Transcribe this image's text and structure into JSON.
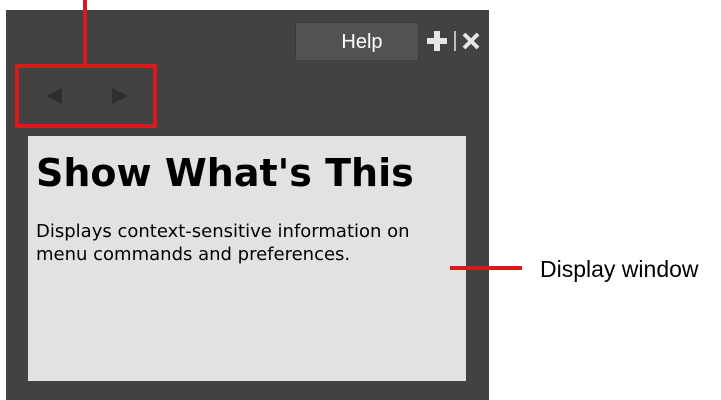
{
  "panel": {
    "tab_label": "Help",
    "icons": {
      "add": "plus-icon",
      "close": "close-icon",
      "back": "back-arrow-icon",
      "forward": "forward-arrow-icon"
    },
    "colors": {
      "panel_bg": "#424242",
      "tab_bg": "#525252",
      "display_bg": "#e2e2e2",
      "annotation": "#d91a1a"
    }
  },
  "display": {
    "title": "Show What's This",
    "body": "Displays context-sensitive information on menu commands and preferences."
  },
  "annotations": {
    "display_window_label": "Display window"
  }
}
